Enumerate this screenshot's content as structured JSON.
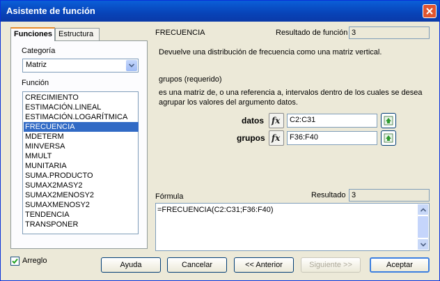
{
  "window": {
    "title": "Asistente de función"
  },
  "tabs": [
    {
      "label": "Funciones"
    },
    {
      "label": "Estructura"
    }
  ],
  "category": {
    "label": "Categoría",
    "value": "Matriz"
  },
  "function_list": {
    "label": "Función",
    "items": [
      "CRECIMIENTO",
      "ESTIMACIÓN.LINEAL",
      "ESTIMACIÓN.LOGARÍTMICA",
      "FRECUENCIA",
      "MDETERM",
      "MINVERSA",
      "MMULT",
      "MUNITARIA",
      "SUMA.PRODUCTO",
      "SUMAX2MASY2",
      "SUMAX2MENOSY2",
      "SUMAXMENOSY2",
      "TENDENCIA",
      "TRANSPONER"
    ],
    "selected": "FRECUENCIA"
  },
  "function_name": "FRECUENCIA",
  "function_result": {
    "label": "Resultado de función",
    "value": "3"
  },
  "description": "Devuelve una distribución de frecuencia como una matriz vertical.",
  "param_title": "grupos (requerido)",
  "param_desc_line1": "es una matriz de, o una referencia a, intervalos dentro de los cuales se desea",
  "param_desc_line2": "agrupar los valores del argumento datos.",
  "args": [
    {
      "label": "datos",
      "value": "C2:C31"
    },
    {
      "label": "grupos",
      "value": "F36:F40"
    }
  ],
  "formula": {
    "label": "Fórmula",
    "value": "=FRECUENCIA(C2:C31;F36:F40)"
  },
  "result": {
    "label": "Resultado",
    "value": "3"
  },
  "array_checkbox": {
    "label": "Arreglo",
    "checked": true
  },
  "buttons": {
    "help": "Ayuda",
    "cancel": "Cancelar",
    "back": "<< Anterior",
    "next": "Siguiente >>",
    "accept": "Aceptar"
  },
  "colors": {
    "title_bar": "#0a5fd8",
    "selection": "#316ac5",
    "default_button_border": "#3c7fe0"
  }
}
